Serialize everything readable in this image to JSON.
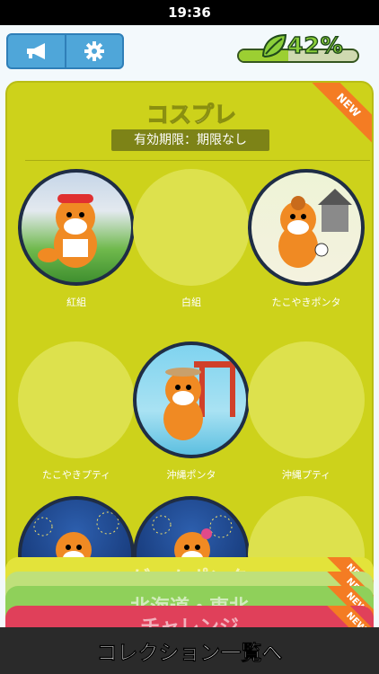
{
  "status": {
    "time": "19:36"
  },
  "topbar": {
    "megaphone_icon": "megaphone-icon",
    "settings_icon": "gear-icon",
    "battery_percent": "42%",
    "battery_level": 0.42,
    "leaf_icon": "leaf-icon"
  },
  "card": {
    "title": "コスプレ",
    "period": "有効期限：期限なし",
    "new_badge": "NEW",
    "badges": [
      {
        "label": "紅組",
        "owned": true
      },
      {
        "label": "白組",
        "owned": false
      },
      {
        "label": "たこやきポンタ",
        "owned": true
      },
      {
        "label": "たこやきプティ",
        "owned": false
      },
      {
        "label": "沖縄ポンタ",
        "owned": true
      },
      {
        "label": "沖縄プティ",
        "owned": false
      },
      {
        "label": "",
        "owned": true
      },
      {
        "label": "",
        "owned": true
      },
      {
        "label": "",
        "owned": false
      }
    ]
  },
  "stacked_cards": [
    {
      "title": "ゲームポンタ",
      "new": "NEW",
      "color": "#e3e33a"
    },
    {
      "title": "",
      "new": "NEW",
      "color": "#bfe07a"
    },
    {
      "title": "北海道・東北",
      "new": "NEW",
      "color": "#8fd05a"
    },
    {
      "title": "チャレンジ",
      "new": "NEW",
      "color": "#e0405a"
    }
  ],
  "footer": {
    "label": "コレクション一覧へ"
  },
  "colors": {
    "card_bg": "#cdd21b",
    "accent": "#f47c23",
    "topbar_button": "#4fa6d9"
  }
}
